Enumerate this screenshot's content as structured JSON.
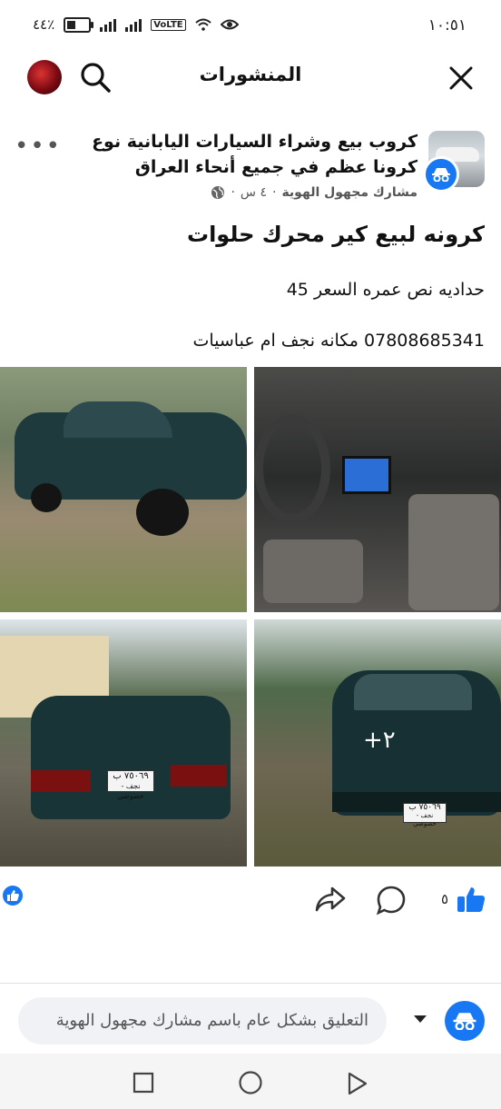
{
  "status_bar": {
    "time": "١٠:٥١",
    "battery": "٤٤٪",
    "network": "VoLTE"
  },
  "app_bar": {
    "title": "المنشورات"
  },
  "post": {
    "group_name": "كروب بيع وشراء السيارات اليابانية نوع كرونا عظم في جميع أنحاء العراق",
    "author": "مشارك مجهول الهوية",
    "time": "٤ س",
    "privacy": "globe-icon",
    "text_line1": "كرونه لبيع  كير محرك حلوات",
    "text_line2": "حداديه نص عمره السعر 45",
    "text_line3": "07808685341 مكانه نجف ام عباسيات",
    "photo_overlay": "+٢",
    "plate_text": "٧٥٠٦٩ ب",
    "plate_sub": "نجف - خصوصي",
    "likes": "٥"
  },
  "comment": {
    "placeholder": "التعليق بشكل عام باسم مشارك مجهول الهوية"
  },
  "colors": {
    "accent": "#1877f2"
  }
}
